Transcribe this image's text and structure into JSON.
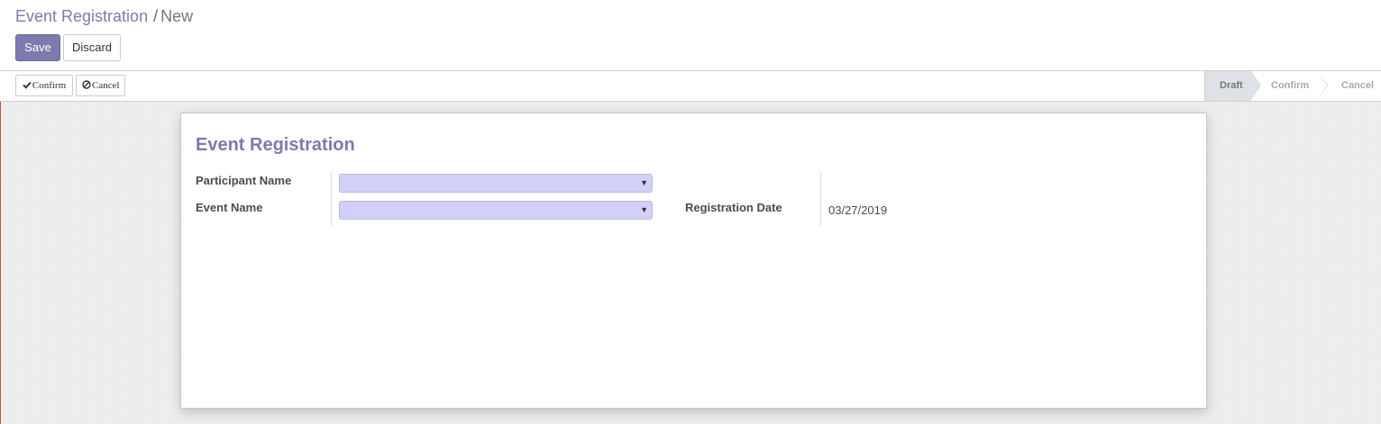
{
  "breadcrumb": {
    "parent": "Event Registration",
    "separator": "/",
    "current": "New"
  },
  "toolbar": {
    "save_label": "Save",
    "discard_label": "Discard"
  },
  "statusbar": {
    "buttons": {
      "confirm_label": "Confirm",
      "cancel_label": "Cancel"
    },
    "stages": [
      {
        "label": "Draft",
        "active": true
      },
      {
        "label": "Confirm",
        "active": false
      },
      {
        "label": "Cancel",
        "active": false
      }
    ]
  },
  "form": {
    "title": "Event Registration",
    "fields": {
      "participant_name_label": "Participant Name",
      "participant_name_value": "",
      "event_name_label": "Event Name",
      "event_name_value": "",
      "registration_date_label": "Registration Date",
      "registration_date_value": "03/27/2019"
    }
  },
  "colors": {
    "brand": "#7c7bad",
    "required_field": "#d2d0f8",
    "active_stage": "#dee2e6"
  },
  "icons": {
    "confirm_icon": "check-icon",
    "cancel_icon": "ban-icon",
    "dropdown_icon": "caret-down-icon"
  }
}
